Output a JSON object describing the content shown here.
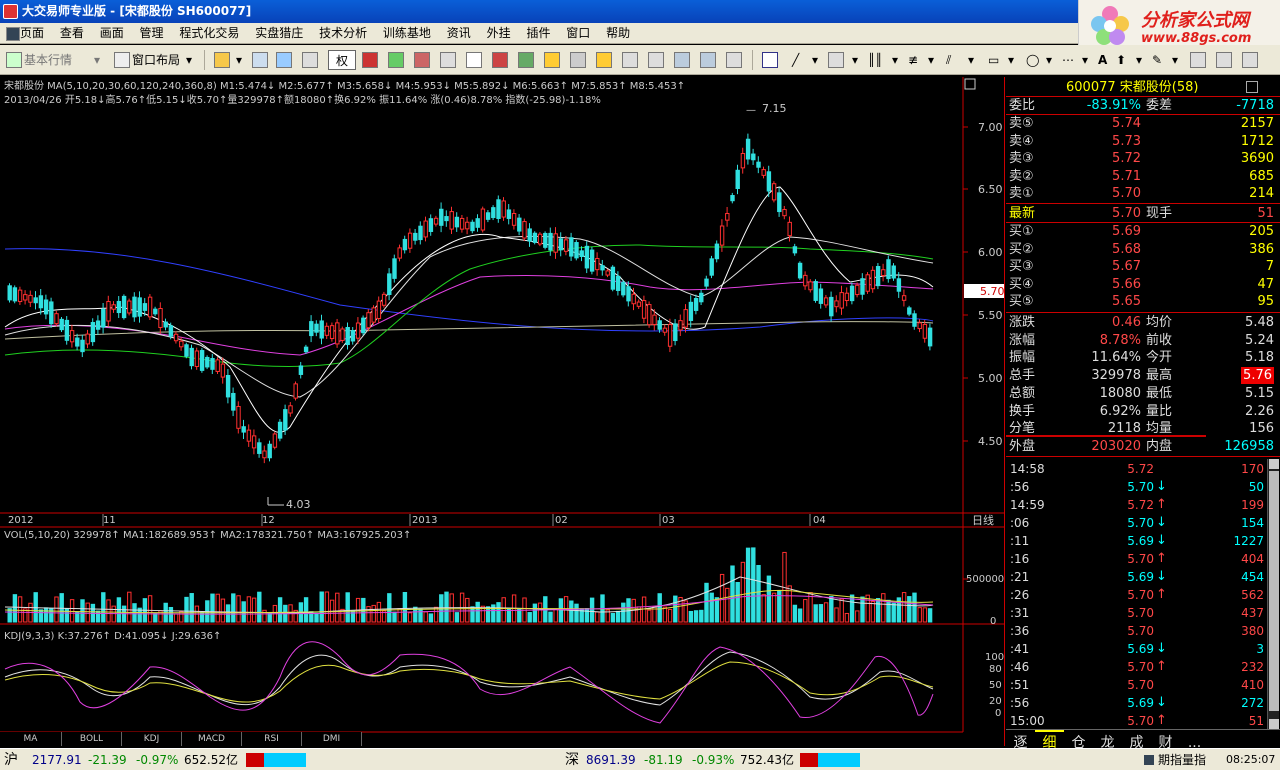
{
  "window": {
    "title": "大交易师专业版  - [宋都股份  SH600077]"
  },
  "logo": {
    "line1": "分析家公式网",
    "line2": "www.88gs.com"
  },
  "menu": [
    "页面",
    "查看",
    "画面",
    "管理",
    "程式化交易",
    "实盘猎庄",
    "技术分析",
    "训练基地",
    "资讯",
    "外挂",
    "插件",
    "窗口",
    "帮助"
  ],
  "toolbar": {
    "quote_label": "基本行情",
    "layout_label": "窗口布局",
    "quan_label": "权"
  },
  "chart": {
    "info_ma": "宋都股份 MA(5,10,20,30,60,120,240,360,8) M1:5.474↓ M2:5.677↑ M3:5.658↓ M4:5.953↓ M5:5.892↓ M6:5.663↑ M7:5.853↑ M8:5.453↑",
    "info_bar": "2013/04/26 开5.18↓高5.76↑低5.15↓收5.70↑量329978↑额18080↑换6.92% 振11.64% 涨(0.46)8.78% 指数(-25.98)-1.18%",
    "high_label": "7.15",
    "low_label": "4.03",
    "current_price": "5.70",
    "price_axis": [
      "7.00",
      "6.50",
      "6.00",
      "5.50",
      "5.00",
      "4.50"
    ],
    "date_axis": [
      "2012",
      "11",
      "12",
      "2013",
      "02",
      "03",
      "04"
    ],
    "period_label": "日线",
    "vol_info": "VOL(5,10,20) 329978↑ MA1:182689.953↑ MA2:178321.750↑ MA3:167925.203↑",
    "vol_axis": [
      "500000",
      "0"
    ],
    "kdj_info": "KDJ(9,3,3) K:37.276↑ D:41.095↓ J:29.636↑",
    "kdj_axis": [
      "100",
      "80",
      "50",
      "20",
      "0"
    ],
    "indicator_tabs": [
      "MA",
      "BOLL",
      "KDJ",
      "MACD",
      "RSI",
      "DMI"
    ]
  },
  "quote": {
    "header": "600077 宋都股份(58)",
    "weibi_label": "委比",
    "weibi": "-83.91%",
    "weicha_label": "委差",
    "weicha": "-7718",
    "sells": [
      {
        "label": "卖⑤",
        "price": "5.74",
        "vol": "2157"
      },
      {
        "label": "卖④",
        "price": "5.73",
        "vol": "1712"
      },
      {
        "label": "卖③",
        "price": "5.72",
        "vol": "3690"
      },
      {
        "label": "卖②",
        "price": "5.71",
        "vol": "685"
      },
      {
        "label": "卖①",
        "price": "5.70",
        "vol": "214"
      }
    ],
    "last_label": "最新",
    "last": "5.70",
    "xianshou_label": "现手",
    "xianshou": "51",
    "buys": [
      {
        "label": "买①",
        "price": "5.69",
        "vol": "205"
      },
      {
        "label": "买②",
        "price": "5.68",
        "vol": "386"
      },
      {
        "label": "买③",
        "price": "5.67",
        "vol": "7"
      },
      {
        "label": "买④",
        "price": "5.66",
        "vol": "47"
      },
      {
        "label": "买⑤",
        "price": "5.65",
        "vol": "95"
      }
    ],
    "stats": [
      {
        "l1": "涨跌",
        "v1": "0.46",
        "l2": "均价",
        "v2": "5.48"
      },
      {
        "l1": "涨幅",
        "v1": "8.78%",
        "l2": "前收",
        "v2": "5.24"
      },
      {
        "l1": "振幅",
        "v1": "11.64%",
        "l2": "今开",
        "v2": "5.18"
      },
      {
        "l1": "总手",
        "v1": "329978",
        "l2": "最高",
        "v2": "5.76"
      },
      {
        "l1": "总额",
        "v1": "18080",
        "l2": "最低",
        "v2": "5.15"
      },
      {
        "l1": "换手",
        "v1": "6.92%",
        "l2": "量比",
        "v2": "2.26"
      },
      {
        "l1": "分笔",
        "v1": "2118",
        "l2": "均量",
        "v2": "156"
      }
    ],
    "outer_label": "外盘",
    "outer": "203020",
    "inner_label": "内盘",
    "inner": "126958"
  },
  "ticks": [
    {
      "t": "14:58",
      "p": "5.72",
      "a": "",
      "v": "170",
      "c": "up"
    },
    {
      "t": ":56",
      "p": "5.70",
      "a": "↓",
      "v": "50",
      "c": "dn"
    },
    {
      "t": "14:59",
      "p": "5.72",
      "a": "↑",
      "v": "199",
      "c": "up"
    },
    {
      "t": ":06",
      "p": "5.70",
      "a": "↓",
      "v": "154",
      "c": "dn"
    },
    {
      "t": ":11",
      "p": "5.69",
      "a": "↓",
      "v": "1227",
      "c": "dn"
    },
    {
      "t": ":16",
      "p": "5.70",
      "a": "↑",
      "v": "404",
      "c": "up"
    },
    {
      "t": ":21",
      "p": "5.69",
      "a": "↓",
      "v": "454",
      "c": "dn"
    },
    {
      "t": ":26",
      "p": "5.70",
      "a": "↑",
      "v": "562",
      "c": "up"
    },
    {
      "t": ":31",
      "p": "5.70",
      "a": "",
      "v": "437",
      "c": "up"
    },
    {
      "t": ":36",
      "p": "5.70",
      "a": "",
      "v": "380",
      "c": "up"
    },
    {
      "t": ":41",
      "p": "5.69",
      "a": "↓",
      "v": "3",
      "c": "dn"
    },
    {
      "t": ":46",
      "p": "5.70",
      "a": "↑",
      "v": "232",
      "c": "up"
    },
    {
      "t": ":51",
      "p": "5.70",
      "a": "",
      "v": "410",
      "c": "up"
    },
    {
      "t": ":56",
      "p": "5.69",
      "a": "↓",
      "v": "272",
      "c": "dn"
    },
    {
      "t": "15:00",
      "p": "5.70",
      "a": "↑",
      "v": "51",
      "c": "up"
    }
  ],
  "right_tabs": [
    "逐",
    "细",
    "仓",
    "龙",
    "成",
    "财",
    "..."
  ],
  "status": {
    "sh_label": "沪",
    "sh_index": "2177.91",
    "sh_chg": "-21.39",
    "sh_pct": "-0.97%",
    "sh_amt": "652.52亿",
    "sz_label": "深",
    "sz_index": "8691.39",
    "sz_chg": "-81.19",
    "sz_pct": "-0.93%",
    "sz_amt": "752.43亿",
    "futures": "期指量指",
    "time": "08:25:07"
  }
}
